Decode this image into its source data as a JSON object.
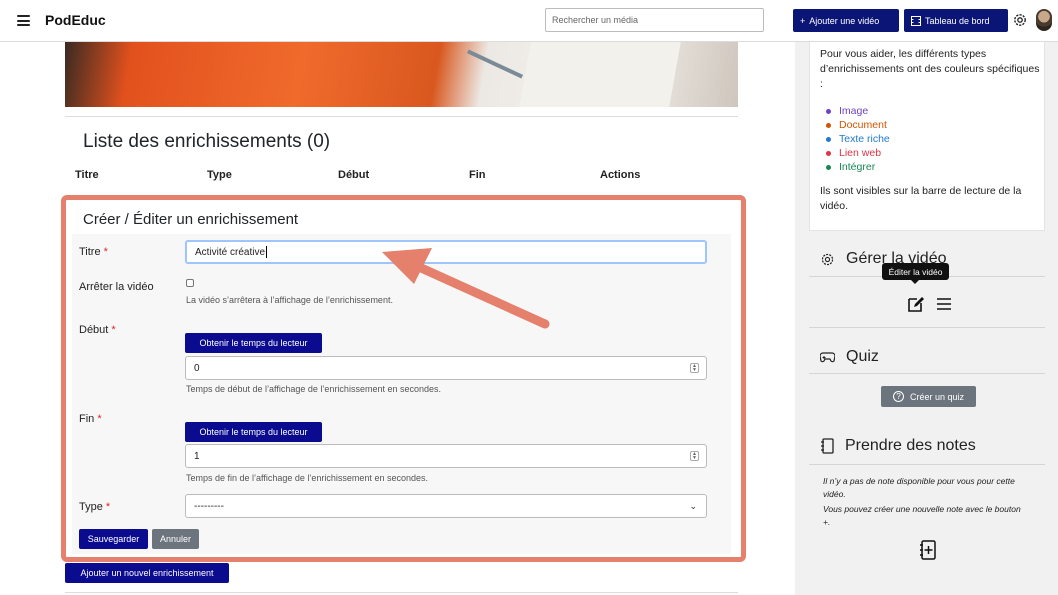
{
  "header": {
    "brand": "PodEduc",
    "search_placeholder": "Rechercher un média",
    "add_video_label": "Ajouter une vidéo",
    "dashboard_label": "Tableau de bord"
  },
  "enrichments": {
    "list_title": "Liste des enrichissements (0)",
    "columns": [
      "Titre",
      "Type",
      "Début",
      "Fin",
      "Actions"
    ]
  },
  "form": {
    "title": "Créer / Éditer un enrichissement",
    "title_label": "Titre",
    "title_value": "Activité créative",
    "stop_video_label": "Arrêter la vidéo",
    "stop_video_help": "La vidéo s’arrêtera à l’affichage de l’enrichissement.",
    "start_label": "Début",
    "get_time_label": "Obtenir le temps du lecteur",
    "start_value": "0",
    "start_help": "Temps de début de l’affichage de l’enrichissement en secondes.",
    "end_label": "Fin",
    "end_value": "1",
    "end_help": "Temps de fin de l’affichage de l’enrichissement en secondes.",
    "type_label": "Type",
    "type_value": "---------",
    "required_mark": "*",
    "save_label": "Sauvegarder",
    "cancel_label": "Annuler"
  },
  "add_enrichment_label": "Ajouter un nouvel enrichissement",
  "sidebar": {
    "help_intro": "Pour vous aider, les différents types d’enrichissements ont des couleurs spécifiques :",
    "legend": [
      {
        "label": "Image",
        "color": "#6f42c1"
      },
      {
        "label": "Document",
        "color": "#d35400"
      },
      {
        "label": "Texte riche",
        "color": "#1f7bd1"
      },
      {
        "label": "Lien web",
        "color": "#dc3545"
      },
      {
        "label": "Intégrer",
        "color": "#198754"
      }
    ],
    "help_outro": "Ils sont visibles sur la barre de lecture de la vidéo.",
    "manage_title": "Gérer la vidéo",
    "tooltip": "Éditer la vidéo",
    "quiz_title": "Quiz",
    "create_quiz_label": "Créer un quiz",
    "notes_title": "Prendre des notes",
    "notes_empty": "Il n’y a pas de note disponible pour vous pour cette vidéo.",
    "notes_hint": "Vous pouvez créer une nouvelle note avec le bouton +."
  }
}
